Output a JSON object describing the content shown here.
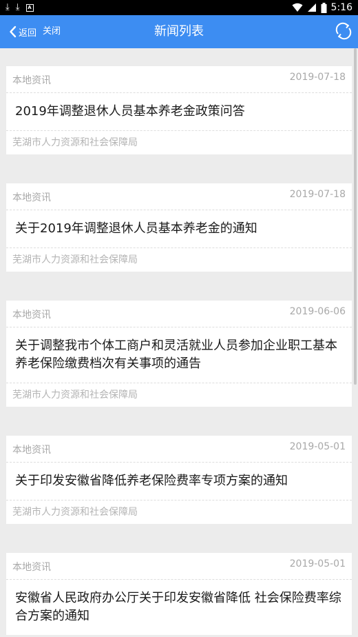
{
  "status": {
    "time": "5:16"
  },
  "nav": {
    "back_label": "返回",
    "close_label": "关闭",
    "title": "新闻列表"
  },
  "news": [
    {
      "category": "本地资讯",
      "date": "2019-07-18",
      "title": "2019年调整退休人员基本养老金政策问答",
      "source": "芜湖市人力资源和社会保障局"
    },
    {
      "category": "本地资讯",
      "date": "2019-07-18",
      "title": "关于2019年调整退休人员基本养老金的通知",
      "source": "芜湖市人力资源和社会保障局"
    },
    {
      "category": "本地资讯",
      "date": "2019-06-06",
      "title": "关于调整我市个体工商户和灵活就业人员参加企业职工基本养老保险缴费档次有关事项的通告",
      "source": "芜湖市人力资源和社会保障局"
    },
    {
      "category": "本地资讯",
      "date": "2019-05-01",
      "title": "关于印发安徽省降低养老保险费率专项方案的通知",
      "source": "芜湖市人力资源和社会保障局"
    },
    {
      "category": "本地资讯",
      "date": "2019-05-01",
      "title": "安徽省人民政府办公厅关于印发安徽省降低 社会保险费率综合方案的通知",
      "source": ""
    }
  ]
}
